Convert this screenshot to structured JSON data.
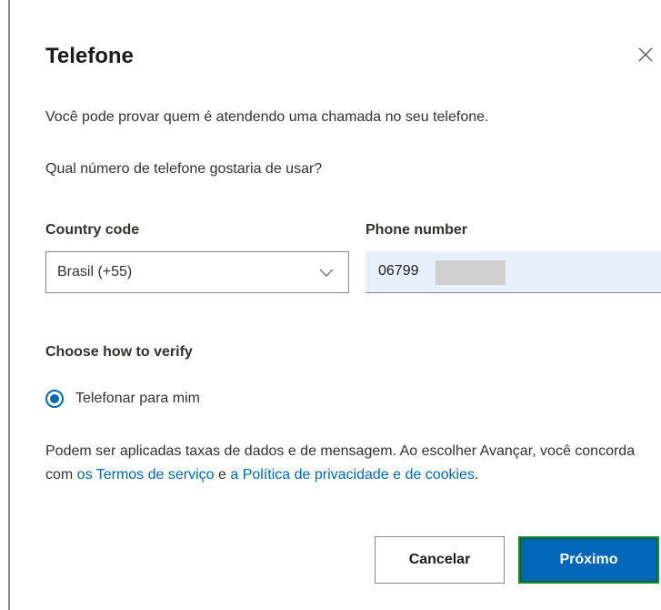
{
  "dialog": {
    "title": "Telefone",
    "description": "Você pode provar quem é atendendo uma chamada no seu telefone.",
    "question": "Qual número de telefone gostaria de usar?"
  },
  "form": {
    "country_code_label": "Country code",
    "country_code_value": "Brasil (+55)",
    "phone_number_label": "Phone number",
    "phone_number_value": "06799"
  },
  "verify": {
    "title": "Choose how to verify",
    "option_label": "Telefonar para mim",
    "option_selected": true
  },
  "terms": {
    "text_before": "Podem ser aplicadas taxas de dados e de mensagem. Ao escolher Avançar, você concorda com ",
    "link_terms": "os Termos de serviço",
    "text_middle": " e ",
    "link_privacy": "a Política de privacidade e de cookies",
    "text_after": "."
  },
  "buttons": {
    "cancel": "Cancelar",
    "next": "Próximo"
  },
  "colors": {
    "accent": "#0067b8",
    "focus_outline": "#1b8c3a",
    "phone_field_bg": "#e8f0fe"
  },
  "icons": {
    "close": "close-icon",
    "dropdown": "chevron-down-icon"
  }
}
